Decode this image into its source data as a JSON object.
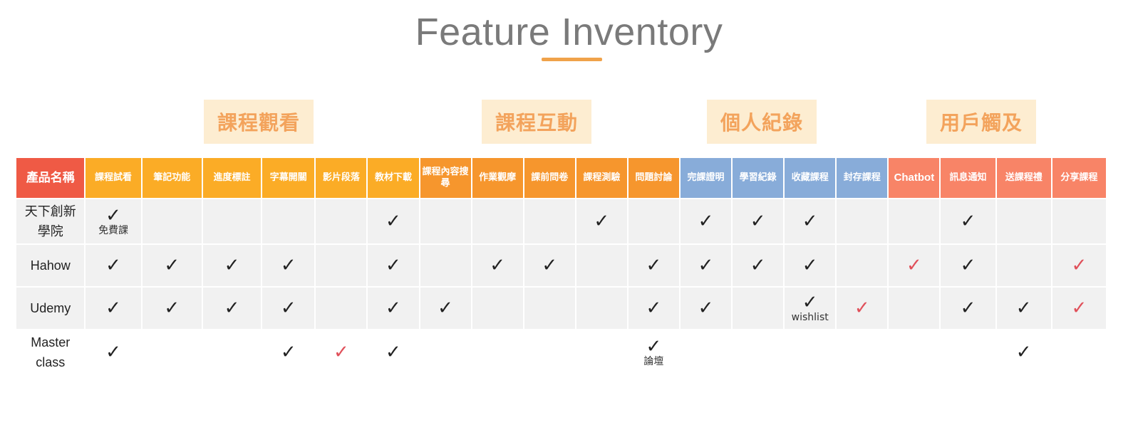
{
  "title": "Feature Inventory",
  "groups": [
    "課程觀看",
    "課程互動",
    "個人紀錄",
    "用戶觸及"
  ],
  "colors": {
    "name_header": "#ef5a45",
    "watch": "#fbac26",
    "interact": "#f6962d",
    "record": "#88acd9",
    "reach": "#f88467",
    "red_check": "#e0505a",
    "row_shade": "#f1f1f1",
    "title_underline": "#f0a24a"
  },
  "header": {
    "name": "產品名稱",
    "columns": [
      "課程試看",
      "筆記功能",
      "進度標註",
      "字幕開關",
      "影片段落",
      "教材下載",
      "課程內容搜尋",
      "作業觀摩",
      "課前問卷",
      "課程測驗",
      "問題討論",
      "完課證明",
      "學習紀錄",
      "收藏課程",
      "封存課程",
      "Chatbot",
      "訊息通知",
      "送課程禮",
      "分享課程"
    ]
  },
  "products": [
    {
      "name": "天下創新學院",
      "cells": [
        {
          "check": "✓",
          "red": false,
          "note": "免費課"
        },
        {
          "check": "",
          "red": false,
          "note": ""
        },
        {
          "check": "",
          "red": false,
          "note": ""
        },
        {
          "check": "",
          "red": false,
          "note": ""
        },
        {
          "check": "",
          "red": false,
          "note": ""
        },
        {
          "check": "✓",
          "red": false,
          "note": ""
        },
        {
          "check": "",
          "red": false,
          "note": ""
        },
        {
          "check": "",
          "red": false,
          "note": ""
        },
        {
          "check": "",
          "red": false,
          "note": ""
        },
        {
          "check": "✓",
          "red": false,
          "note": ""
        },
        {
          "check": "",
          "red": false,
          "note": ""
        },
        {
          "check": "✓",
          "red": false,
          "note": ""
        },
        {
          "check": "✓",
          "red": false,
          "note": ""
        },
        {
          "check": "✓",
          "red": false,
          "note": ""
        },
        {
          "check": "",
          "red": false,
          "note": ""
        },
        {
          "check": "",
          "red": false,
          "note": ""
        },
        {
          "check": "✓",
          "red": false,
          "note": ""
        },
        {
          "check": "",
          "red": false,
          "note": ""
        },
        {
          "check": "",
          "red": false,
          "note": ""
        }
      ]
    },
    {
      "name": "Hahow",
      "cells": [
        {
          "check": "✓",
          "red": false,
          "note": ""
        },
        {
          "check": "✓",
          "red": false,
          "note": ""
        },
        {
          "check": "✓",
          "red": false,
          "note": ""
        },
        {
          "check": "✓",
          "red": false,
          "note": ""
        },
        {
          "check": "",
          "red": false,
          "note": ""
        },
        {
          "check": "✓",
          "red": false,
          "note": ""
        },
        {
          "check": "",
          "red": false,
          "note": ""
        },
        {
          "check": "✓",
          "red": false,
          "note": ""
        },
        {
          "check": "✓",
          "red": false,
          "note": ""
        },
        {
          "check": "",
          "red": false,
          "note": ""
        },
        {
          "check": "✓",
          "red": false,
          "note": ""
        },
        {
          "check": "✓",
          "red": false,
          "note": ""
        },
        {
          "check": "✓",
          "red": false,
          "note": ""
        },
        {
          "check": "✓",
          "red": false,
          "note": ""
        },
        {
          "check": "",
          "red": false,
          "note": ""
        },
        {
          "check": "✓",
          "red": true,
          "note": ""
        },
        {
          "check": "✓",
          "red": false,
          "note": ""
        },
        {
          "check": "",
          "red": false,
          "note": ""
        },
        {
          "check": "✓",
          "red": true,
          "note": ""
        }
      ]
    },
    {
      "name": "Udemy",
      "cells": [
        {
          "check": "✓",
          "red": false,
          "note": ""
        },
        {
          "check": "✓",
          "red": false,
          "note": ""
        },
        {
          "check": "✓",
          "red": false,
          "note": ""
        },
        {
          "check": "✓",
          "red": false,
          "note": ""
        },
        {
          "check": "",
          "red": false,
          "note": ""
        },
        {
          "check": "✓",
          "red": false,
          "note": ""
        },
        {
          "check": "✓",
          "red": false,
          "note": ""
        },
        {
          "check": "",
          "red": false,
          "note": ""
        },
        {
          "check": "",
          "red": false,
          "note": ""
        },
        {
          "check": "",
          "red": false,
          "note": ""
        },
        {
          "check": "✓",
          "red": false,
          "note": ""
        },
        {
          "check": "✓",
          "red": false,
          "note": ""
        },
        {
          "check": "",
          "red": false,
          "note": ""
        },
        {
          "check": "✓",
          "red": false,
          "note": "wishlist"
        },
        {
          "check": "✓",
          "red": true,
          "note": ""
        },
        {
          "check": "",
          "red": false,
          "note": ""
        },
        {
          "check": "✓",
          "red": false,
          "note": ""
        },
        {
          "check": "✓",
          "red": false,
          "note": ""
        },
        {
          "check": "✓",
          "red": true,
          "note": ""
        }
      ]
    },
    {
      "name": "Master class",
      "cells": [
        {
          "check": "✓",
          "red": false,
          "note": ""
        },
        {
          "check": "",
          "red": false,
          "note": ""
        },
        {
          "check": "",
          "red": false,
          "note": ""
        },
        {
          "check": "✓",
          "red": false,
          "note": ""
        },
        {
          "check": "✓",
          "red": true,
          "note": ""
        },
        {
          "check": "✓",
          "red": false,
          "note": ""
        },
        {
          "check": "",
          "red": false,
          "note": ""
        },
        {
          "check": "",
          "red": false,
          "note": ""
        },
        {
          "check": "",
          "red": false,
          "note": ""
        },
        {
          "check": "",
          "red": false,
          "note": ""
        },
        {
          "check": "✓",
          "red": false,
          "note": "論壇"
        },
        {
          "check": "",
          "red": false,
          "note": ""
        },
        {
          "check": "",
          "red": false,
          "note": ""
        },
        {
          "check": "",
          "red": false,
          "note": ""
        },
        {
          "check": "",
          "red": false,
          "note": ""
        },
        {
          "check": "",
          "red": false,
          "note": ""
        },
        {
          "check": "",
          "red": false,
          "note": ""
        },
        {
          "check": "✓",
          "red": false,
          "note": ""
        },
        {
          "check": "",
          "red": false,
          "note": ""
        }
      ]
    }
  ]
}
